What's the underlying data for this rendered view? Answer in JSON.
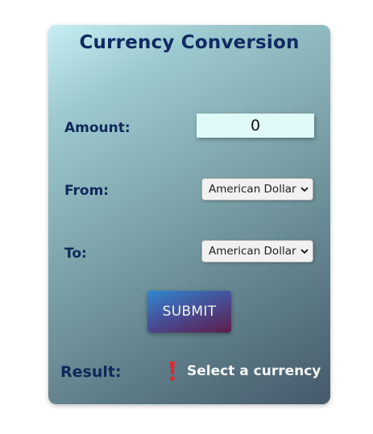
{
  "title": "Currency Conversion",
  "amount": {
    "label": "Amount:",
    "value": "0"
  },
  "from": {
    "label": "From:",
    "selected": "American Dollar"
  },
  "to": {
    "label": "To:",
    "selected": "American Dollar"
  },
  "submit_label": "SUBMIT",
  "result": {
    "label": "Result:",
    "icon": "exclamation-icon",
    "message": "Select a currency"
  },
  "colors": {
    "title": "#102a62",
    "input_bg": "#dff9f8",
    "alert": "#e0282e",
    "result_text": "#f4f6f8"
  }
}
